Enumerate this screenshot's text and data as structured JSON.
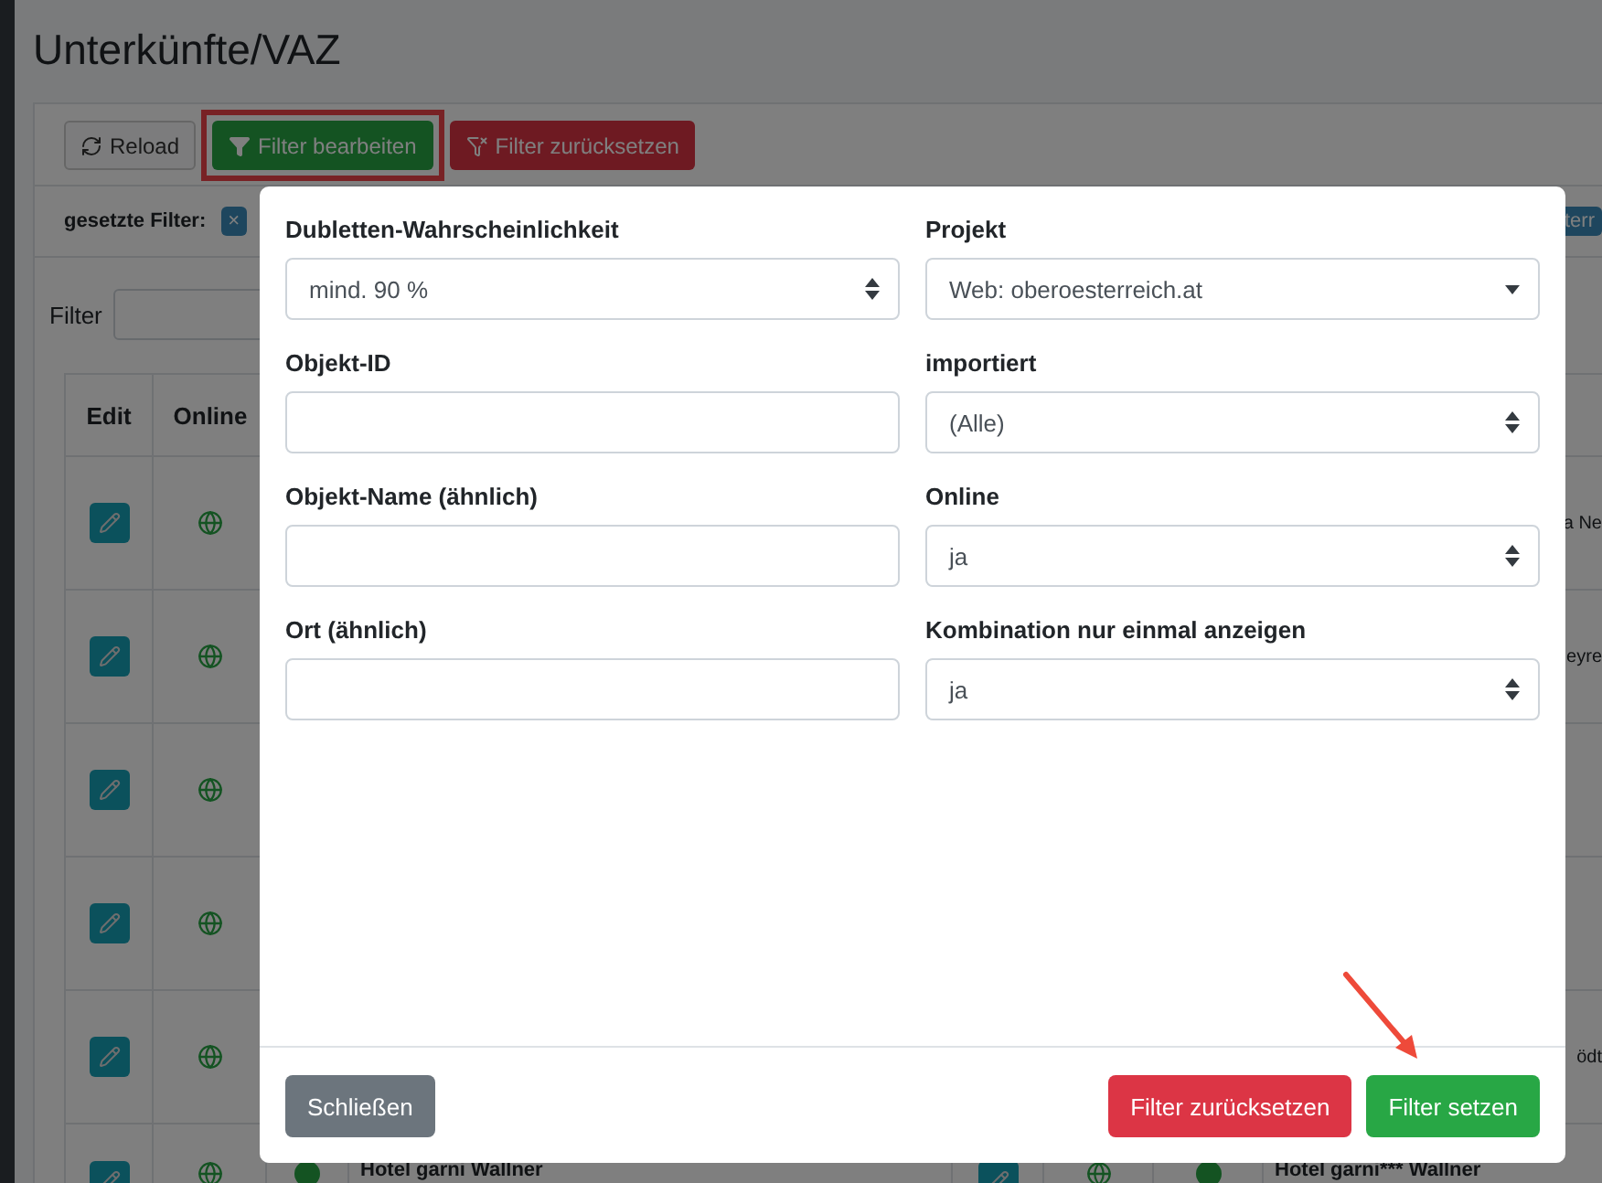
{
  "page": {
    "title": "Unterkünfte/VAZ"
  },
  "toolbar": {
    "buttons": [
      {
        "label": "Reload",
        "kind": "reload",
        "highlighted": false
      },
      {
        "label": "Filter bearbeiten",
        "kind": "edit",
        "highlighted": true
      },
      {
        "label": "Filter zurücksetzen",
        "kind": "reset",
        "highlighted": false
      }
    ]
  },
  "active_filters": {
    "label": "gesetzte Filter:",
    "tags": [
      {
        "label": "×"
      },
      {
        "label": "terr"
      }
    ]
  },
  "filter_field": {
    "label": "Filter"
  },
  "table": {
    "columns": [
      "Edit",
      "Online"
    ],
    "rows": [
      {
        "trailing": "a Ne"
      },
      {
        "trailing": "eyre"
      },
      {},
      {},
      {
        "trailing": "ödt"
      },
      {
        "name": "Hotel garni Wallner",
        "name_2": "Hotel garni*** Wallner"
      }
    ]
  },
  "modal": {
    "fields": [
      {
        "label": "Dubletten-Wahrscheinlichkeit",
        "kind": "select",
        "value": "mind. 90 %"
      },
      {
        "label": "Projekt",
        "kind": "dropdown",
        "value": "Web: oberoesterreich.at"
      },
      {
        "label": "Objekt-ID",
        "kind": "input"
      },
      {
        "label": "importiert",
        "kind": "select",
        "value": "(Alle)"
      },
      {
        "label": "Objekt-Name (ähnlich)",
        "kind": "input"
      },
      {
        "label": "Online",
        "kind": "select",
        "value": "ja"
      },
      {
        "label": "Ort (ähnlich)",
        "kind": "input"
      },
      {
        "label": "Kombination nur einmal anzeigen",
        "kind": "select",
        "value": "ja"
      }
    ],
    "buttons": [
      {
        "label": "Schließen",
        "kind": "close"
      },
      {
        "label": "Filter zurücksetzen",
        "kind": "reset"
      },
      {
        "label": "Filter setzen",
        "kind": "apply",
        "annotated": true
      }
    ]
  }
}
